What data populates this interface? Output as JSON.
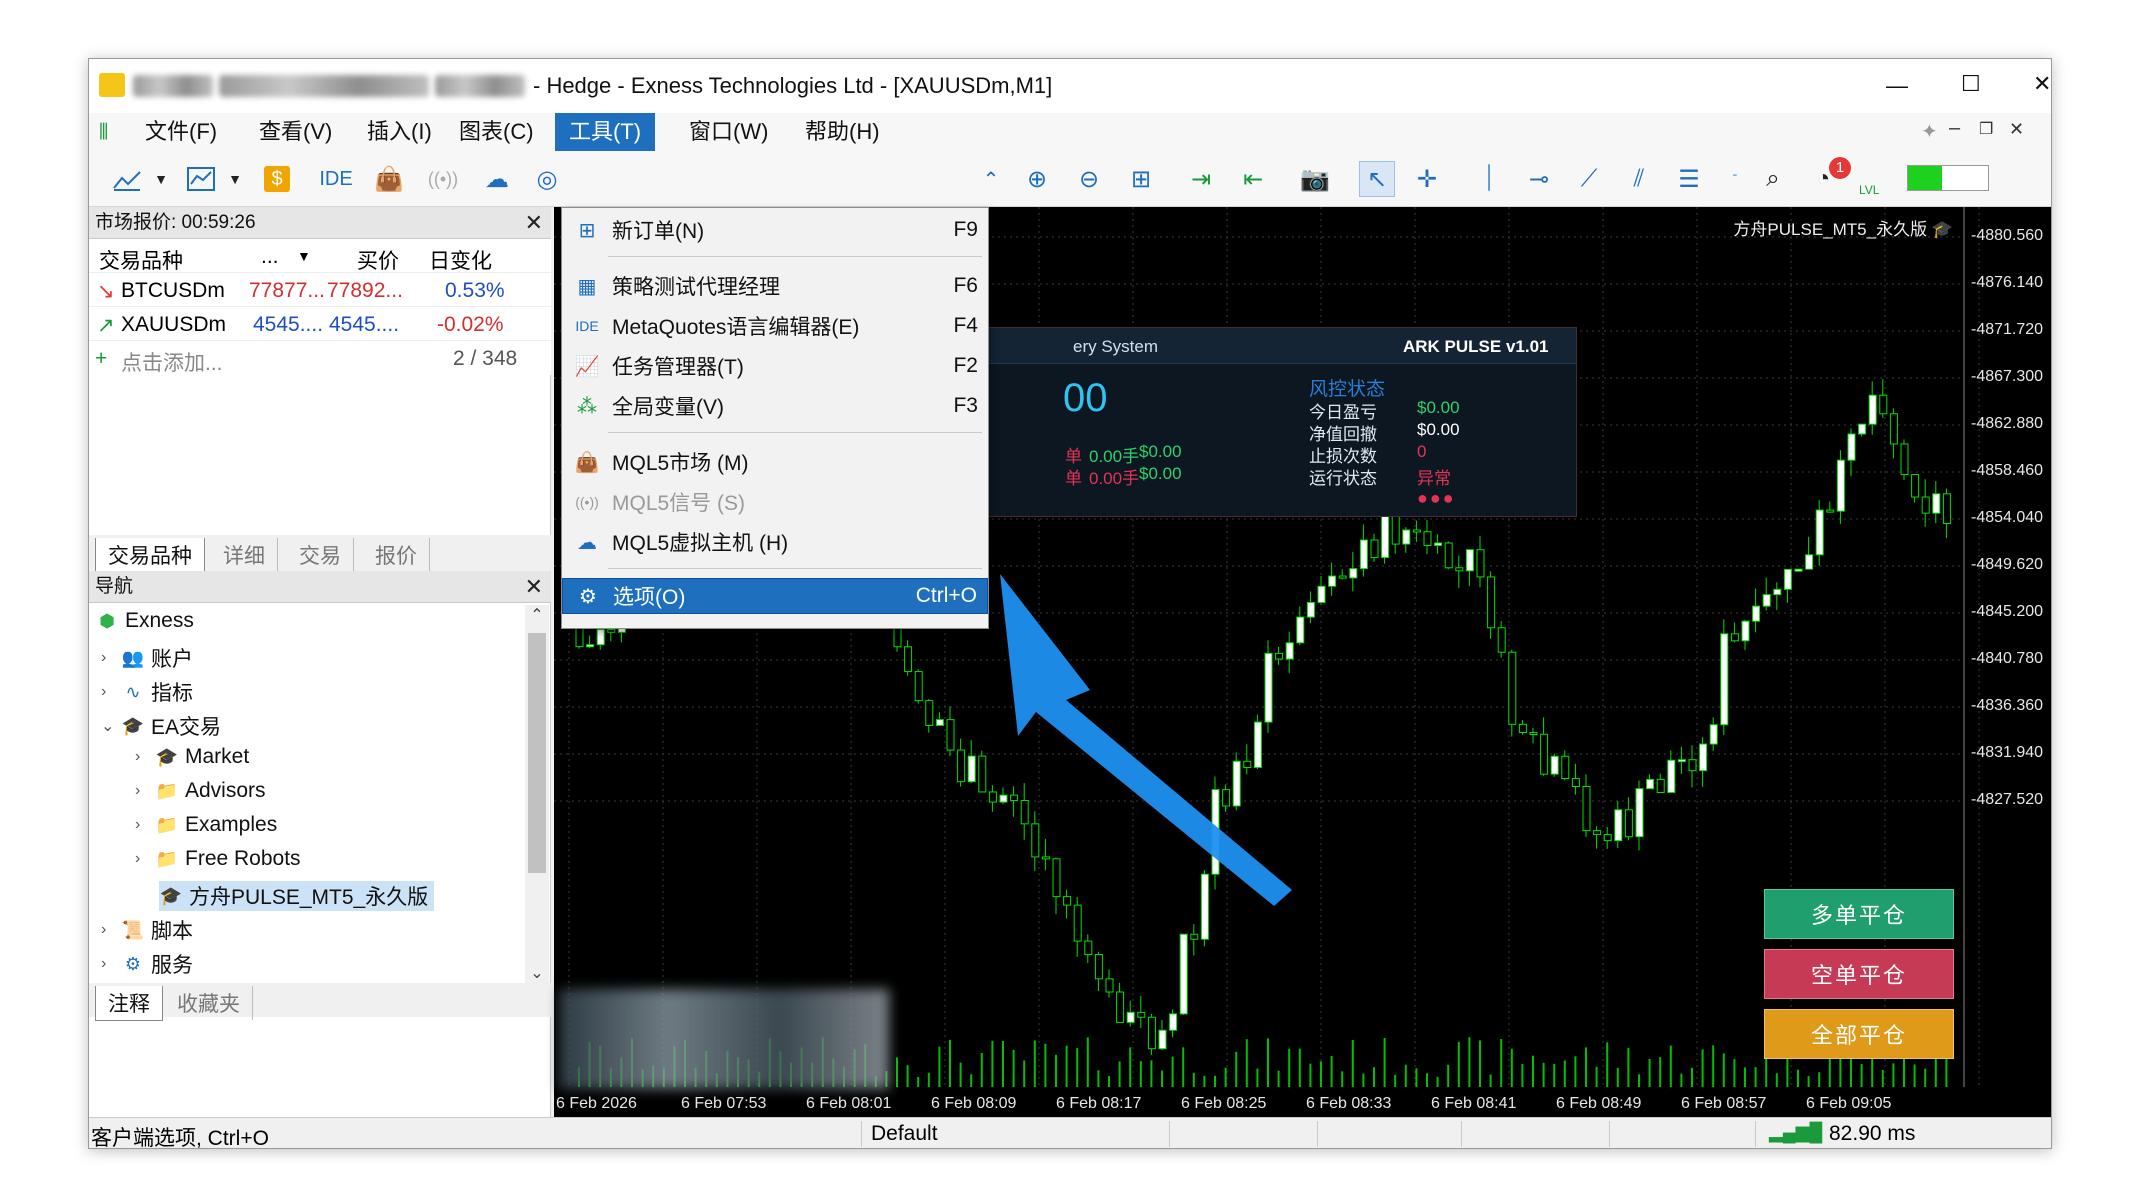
{
  "window": {
    "title_suffix": "- Hedge - Exness Technologies Ltd - [XAUUSDm,M1]",
    "controls": {
      "minimize": "—",
      "maximize": "☐",
      "close": "✕"
    }
  },
  "menu": {
    "items": [
      "文件(F)",
      "查看(V)",
      "插入(I)",
      "图表(C)",
      "工具(T)",
      "窗口(W)",
      "帮助(H)"
    ],
    "active": "工具(T)"
  },
  "toolbar": {
    "ide_label": "IDE",
    "notification_count": "1",
    "lvl_label": "LVL"
  },
  "market_watch": {
    "title": "市场报价: 00:59:26",
    "columns": [
      "交易品种",
      "...",
      "买价",
      "日变化"
    ],
    "rows": [
      {
        "symbol": "BTCUSDm",
        "bid": "77877...",
        "ask": "77892...",
        "change": "0.53%",
        "direction": "down"
      },
      {
        "symbol": "XAUUSDm",
        "bid": "4545....",
        "ask": "4545....",
        "change": "-0.02%",
        "direction": "up"
      }
    ],
    "add_label": "点击添加...",
    "count": "2 / 348",
    "tabs": [
      "交易品种",
      "详细",
      "交易",
      "报价"
    ]
  },
  "navigator": {
    "title": "导航",
    "items": [
      {
        "label": "Exness",
        "icon": "exness-logo-icon",
        "indent": 0
      },
      {
        "label": "账户",
        "icon": "accounts-icon",
        "indent": 1
      },
      {
        "label": "指标",
        "icon": "indicator-icon",
        "indent": 1
      },
      {
        "label": "EA交易",
        "icon": "expert-hat-icon",
        "indent": 1
      },
      {
        "label": "Market",
        "icon": "expert-hat-icon",
        "indent": 2
      },
      {
        "label": "Advisors",
        "icon": "folder-icon",
        "indent": 2
      },
      {
        "label": "Examples",
        "icon": "folder-icon",
        "indent": 2
      },
      {
        "label": "Free Robots",
        "icon": "folder-icon",
        "indent": 2
      },
      {
        "label": "方舟PULSE_MT5_永久版",
        "icon": "expert-hat-icon",
        "indent": 2
      },
      {
        "label": "脚本",
        "icon": "script-icon",
        "indent": 1
      },
      {
        "label": "服务",
        "icon": "service-gear-icon",
        "indent": 1
      }
    ],
    "tabs": [
      "注释",
      "收藏夹"
    ]
  },
  "tools_menu": {
    "items": [
      {
        "icon": "new-order-icon",
        "label": "新订单(N)",
        "key": "F9"
      },
      {
        "icon": "strategy-tester-icon",
        "label": "策略测试代理经理",
        "key": "F6"
      },
      {
        "icon": "ide-icon",
        "label": "MetaQuotes语言编辑器(E)",
        "key": "F4"
      },
      {
        "icon": "task-manager-icon",
        "label": "任务管理器(T)",
        "key": "F2"
      },
      {
        "icon": "global-variables-icon",
        "label": "全局变量(V)",
        "key": "F3"
      },
      {
        "icon": "mql5-market-icon",
        "label": "MQL5市场 (M)",
        "key": ""
      },
      {
        "icon": "mql5-signals-icon",
        "label": "MQL5信号 (S)",
        "key": ""
      },
      {
        "icon": "mql5-vps-icon",
        "label": "MQL5虚拟主机 (H)",
        "key": ""
      },
      {
        "icon": "options-gear-icon",
        "label": "选项(O)",
        "key": "Ctrl+O"
      }
    ]
  },
  "chart": {
    "ea_name": "方舟PULSE_MT5_永久版",
    "price_labels": [
      "4880.560",
      "4876.140",
      "4871.720",
      "4867.300",
      "4862.880",
      "4858.460",
      "4854.040",
      "4849.620",
      "4845.200",
      "4840.780",
      "4836.360",
      "4831.940",
      "4827.520"
    ],
    "time_labels": [
      "6 Feb 2026",
      "6 Feb 07:53",
      "6 Feb 08:01",
      "6 Feb 08:09",
      "6 Feb 08:17",
      "6 Feb 08:25",
      "6 Feb 08:33",
      "6 Feb 08:41",
      "6 Feb 08:49",
      "6 Feb 08:57",
      "6 Feb 09:05"
    ],
    "colors": {
      "bull": "#ffffff",
      "bear": "#000000",
      "outline": "#00e000",
      "grid": "#3a3a3a",
      "volume": "#00c000"
    }
  },
  "ea_panel": {
    "system_label": "ery System",
    "version": "ARK PULSE v1.01",
    "big_value": "00",
    "left_label_1": "单",
    "left_label_2": "单",
    "lots_1": "0.00手",
    "lots_2": "0.00手",
    "money_1": "$0.00",
    "money_2": "$0.00",
    "risk_title": "风控状态",
    "risk_rows": [
      {
        "label": "今日盈亏",
        "value": "$0.00"
      },
      {
        "label": "净值回撤",
        "value": "$0.00"
      },
      {
        "label": "止损次数",
        "value": "0"
      },
      {
        "label": "运行状态",
        "value": "异常"
      }
    ],
    "status_dots": "●●●"
  },
  "action_buttons": [
    {
      "label": "多单平仓",
      "color": "#1f9e6e"
    },
    {
      "label": "空单平仓",
      "color": "#c63a55"
    },
    {
      "label": "全部平仓",
      "color": "#e09a1a"
    }
  ],
  "statusbar": {
    "hint": "客户端选项, Ctrl+O",
    "profile": "Default",
    "ping": "82.90 ms"
  }
}
